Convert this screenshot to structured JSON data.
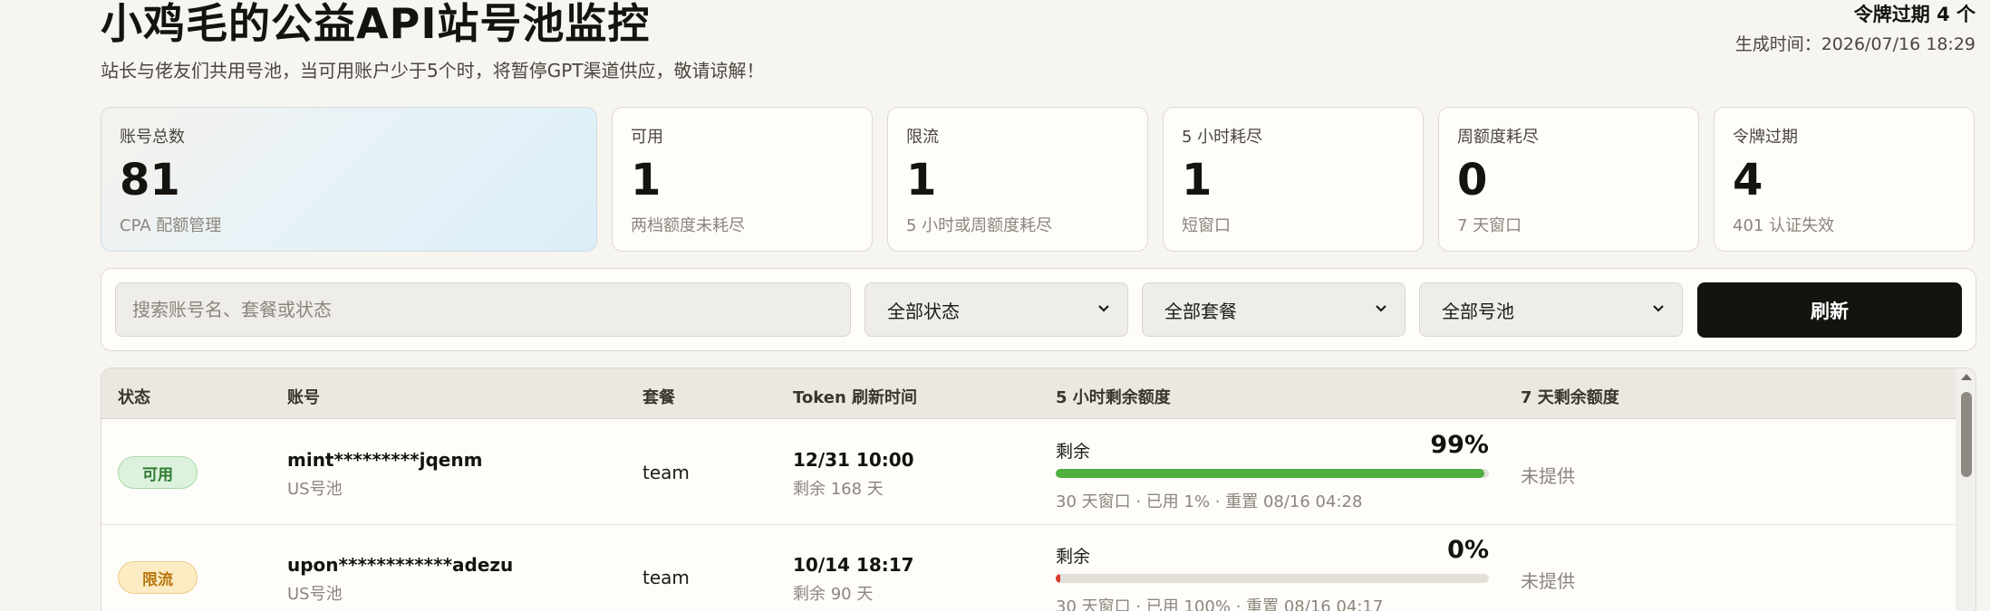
{
  "header": {
    "title": "小鸡毛的公益API站号池监控",
    "subtitle": "站长与佬友们共用号池，当可用账户少于5个时，将暂停GPT渠道供应，敬请谅解！",
    "expired_summary": "令牌过期 4 个",
    "generated": "生成时间：2026/07/16 18:29"
  },
  "cards": [
    {
      "label": "账号总数",
      "value": "81",
      "note": "CPA 配额管理"
    },
    {
      "label": "可用",
      "value": "1",
      "note": "两档额度未耗尽"
    },
    {
      "label": "限流",
      "value": "1",
      "note": "5 小时或周额度耗尽"
    },
    {
      "label": "5 小时耗尽",
      "value": "1",
      "note": "短窗口"
    },
    {
      "label": "周额度耗尽",
      "value": "0",
      "note": "7 天窗口"
    },
    {
      "label": "令牌过期",
      "value": "4",
      "note": "401 认证失效"
    }
  ],
  "filters": {
    "search_placeholder": "搜索账号名、套餐或状态",
    "status": "全部状态",
    "plan": "全部套餐",
    "pool": "全部号池",
    "refresh": "刷新"
  },
  "table": {
    "columns": [
      "状态",
      "账号",
      "套餐",
      "Token 刷新时间",
      "5 小时剩余额度",
      "7 天剩余额度"
    ],
    "rows": [
      {
        "status": "可用",
        "status_kind": "ok",
        "name": "mint*********jqenm",
        "pool": "US号池",
        "plan": "team",
        "token_time": "12/31 10:00",
        "token_left": "剩余 168 天",
        "quota_label": "剩余",
        "quota_pct": "99%",
        "quota_fill": 0.99,
        "quota_color": "#4caf3e",
        "quota_meta": "30 天窗口 · 已用 1% · 重置 08/16 04:28",
        "q7": "未提供"
      },
      {
        "status": "限流",
        "status_kind": "limit",
        "name": "upon************adezu",
        "pool": "US号池",
        "plan": "team",
        "token_time": "10/14 18:17",
        "token_left": "剩余 90 天",
        "quota_label": "剩余",
        "quota_pct": "0%",
        "quota_fill": 0.0,
        "quota_color": "#d93b2b",
        "quota_meta": "30 天窗口 · 已用 100% · 重置 08/16 04:17",
        "q7": "未提供"
      }
    ]
  },
  "colors": {
    "accent_dark": "#15130f",
    "ok": "#2f7a34",
    "limit": "#b8760d"
  },
  "icons": {
    "select_arrow": "chevron-down-icon",
    "scroll_up": "scroll-up-arrow-icon"
  }
}
